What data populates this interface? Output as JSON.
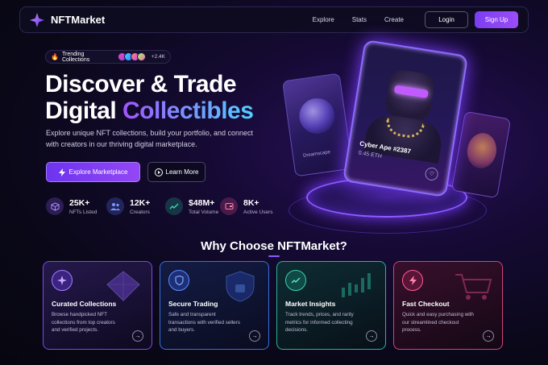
{
  "nav": {
    "brand": "NFTMarket",
    "links": [
      "Explore",
      "Stats",
      "Create"
    ],
    "login": "Login",
    "signup": "Sign Up"
  },
  "hero": {
    "trend_label": "Trending Collections",
    "trend_count": "+2.4K",
    "title_line1": "Discover & Trade",
    "title_line2a": "Digital ",
    "title_line2b": "Collectibles",
    "subtitle": "Explore unique NFT collections, build your portfolio, and connect with creators in our thriving digital marketplace.",
    "btn_explore": "Explore Marketplace",
    "btn_learn": "Learn More"
  },
  "stats": [
    {
      "value": "25K+",
      "label": "NFTs Listed",
      "icon": "cube-icon",
      "color": "#8b5cf6"
    },
    {
      "value": "12K+",
      "label": "Creators",
      "icon": "users-icon",
      "color": "#5b7dff"
    },
    {
      "value": "$48M+",
      "label": "Total Volume",
      "icon": "trend-icon",
      "color": "#2fd0a8"
    },
    {
      "value": "8K+",
      "label": "Active Users",
      "icon": "wallet-icon",
      "color": "#ff5c95"
    }
  ],
  "art": {
    "card_title": "Cyber Ape #2387",
    "card_price": "0.45 ETH",
    "left_label": "Dreamscape"
  },
  "why": {
    "title": "Why Choose NFTMarket?"
  },
  "features": [
    {
      "title": "Curated Collections",
      "desc": "Browse handpicked NFT collections from top creators and verified projects.",
      "icon": "sparkle-icon",
      "color": "#a57cff"
    },
    {
      "title": "Secure Trading",
      "desc": "Safe and transparent transactions with verified sellers and buyers.",
      "icon": "shield-icon",
      "color": "#5a8dff"
    },
    {
      "title": "Market Insights",
      "desc": "Track trends, prices, and rarity metrics for informed collecting decisions.",
      "icon": "chart-icon",
      "color": "#39d1b0"
    },
    {
      "title": "Fast Checkout",
      "desc": "Quick and easy purchasing with our streamlined checkout process.",
      "icon": "bolt-icon",
      "color": "#ff5c95"
    }
  ]
}
